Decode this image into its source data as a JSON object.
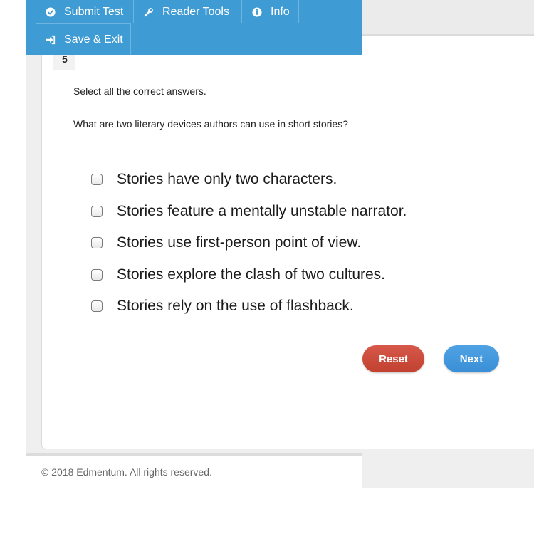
{
  "toolbar": {
    "submit_label": "Submit Test",
    "reader_label": "Reader Tools",
    "info_label": "Info",
    "save_label": "Save & Exit",
    "color": "#3e9bd3"
  },
  "question": {
    "number": "5",
    "instruction": "Select all the correct answers.",
    "prompt": "What are two literary devices authors can use in short stories?",
    "choices": [
      "Stories have only two characters.",
      "Stories feature a mentally unstable narrator.",
      "Stories use first-person point of view.",
      "Stories explore the clash of two cultures.",
      "Stories rely on the use of flashback."
    ]
  },
  "actions": {
    "reset_label": "Reset",
    "next_label": "Next",
    "reset_color": "#c84a3b",
    "next_color": "#4499dd"
  },
  "footer": {
    "copyright": "© 2018 Edmentum. All rights reserved."
  }
}
